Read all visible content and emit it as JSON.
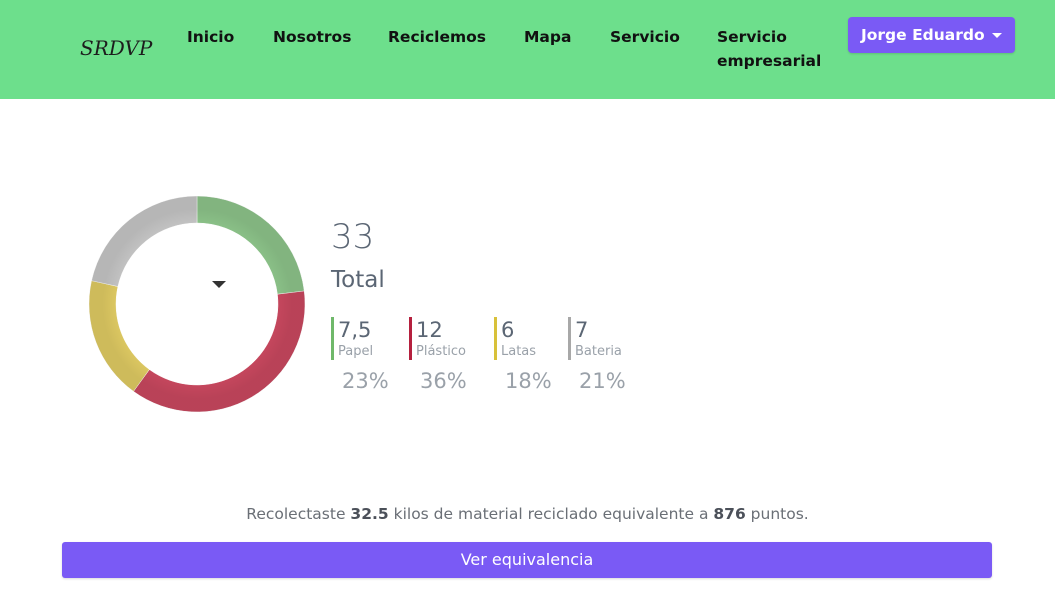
{
  "nav": {
    "brand": "SRDVP",
    "items": [
      "Inicio",
      "Nosotros",
      "Reciclemos",
      "Mapa",
      "Servicio",
      "Servicio empresarial"
    ],
    "user_label": "Jorge Eduardo"
  },
  "summary_stats": {
    "total": "33",
    "total_label": "Total",
    "categories": [
      {
        "value": "7,5",
        "label": "Papel",
        "percent": "23%",
        "color": "#6fb86a"
      },
      {
        "value": "12",
        "label": "Plástico",
        "percent": "36%",
        "color": "#b5203e"
      },
      {
        "value": "6",
        "label": "Latas",
        "percent": "18%",
        "color": "#d8c13a"
      },
      {
        "value": "7",
        "label": "Bateria",
        "percent": "21%",
        "color": "#a8a8a8"
      }
    ]
  },
  "chart_data": {
    "type": "pie",
    "categories": [
      "Papel",
      "Plástico",
      "Latas",
      "Bateria"
    ],
    "values": [
      7.5,
      12,
      6,
      7
    ],
    "colors": [
      "#8dc48a",
      "#c9485f",
      "#e0cb63",
      "#c6c6c6"
    ],
    "total": 33
  },
  "summary": {
    "prefix": "Recolectaste ",
    "kilos": "32.5",
    "middle": " kilos de material reciclado equivalente a ",
    "points": "876",
    "suffix": " puntos."
  },
  "equivalence_button": "Ver equivalencia"
}
